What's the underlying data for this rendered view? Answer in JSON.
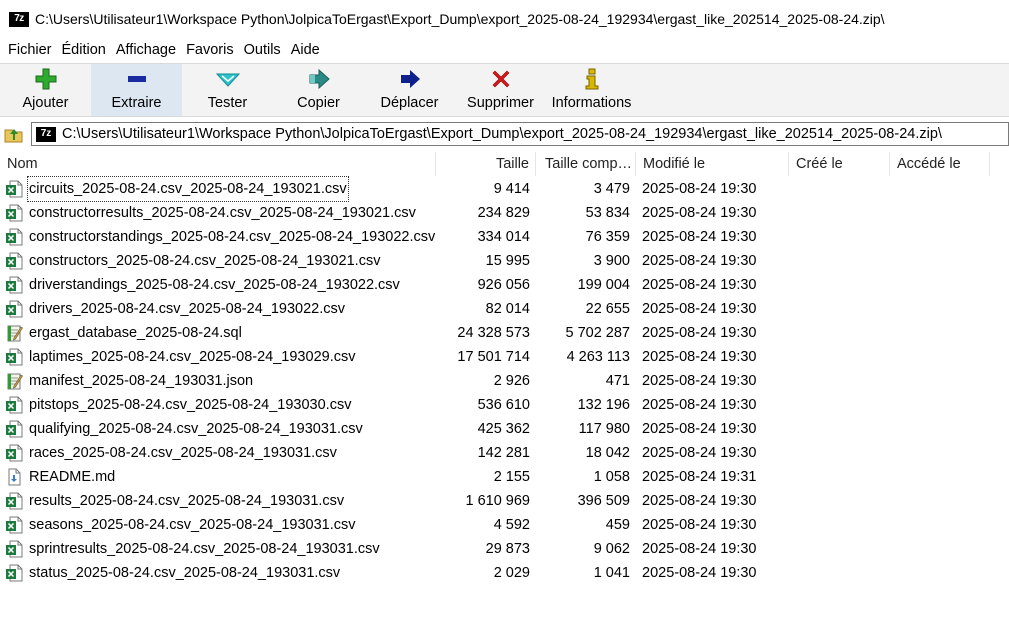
{
  "window": {
    "app_badge": "7z",
    "title": "C:\\Users\\Utilisateur1\\Workspace Python\\JolpicaToErgast\\Export_Dump\\export_2025-08-24_192934\\ergast_like_202514_2025-08-24.zip\\"
  },
  "menu": [
    "Fichier",
    "Édition",
    "Affichage",
    "Favoris",
    "Outils",
    "Aide"
  ],
  "toolbar": [
    {
      "label": "Ajouter",
      "icon": "add-plus-icon",
      "color": "#2eaa2e"
    },
    {
      "label": "Extraire",
      "icon": "extract-minus-icon",
      "color": "#1a2aa0"
    },
    {
      "label": "Tester",
      "icon": "test-check-icon",
      "color": "#29c4cc"
    },
    {
      "label": "Copier",
      "icon": "copy-arrow-icon",
      "color": "#2a8a86"
    },
    {
      "label": "Déplacer",
      "icon": "move-arrow-icon",
      "color": "#10208a"
    },
    {
      "label": "Supprimer",
      "icon": "delete-x-icon",
      "color": "#d81818"
    },
    {
      "label": "Informations",
      "icon": "info-icon",
      "color": "#d8b800"
    }
  ],
  "address": {
    "value": "C:\\Users\\Utilisateur1\\Workspace Python\\JolpicaToErgast\\Export_Dump\\export_2025-08-24_192934\\ergast_like_202514_2025-08-24.zip\\"
  },
  "columns": {
    "name": "Nom",
    "size": "Taille",
    "packed": "Taille comp…",
    "modified": "Modifié le",
    "created": "Créé le",
    "accessed": "Accédé le"
  },
  "files": [
    {
      "name": "circuits_2025-08-24.csv_2025-08-24_193021.csv",
      "size": "9 414",
      "packed": "3 479",
      "modified": "2025-08-24 19:30",
      "type": "csv"
    },
    {
      "name": "constructorresults_2025-08-24.csv_2025-08-24_193021.csv",
      "size": "234 829",
      "packed": "53 834",
      "modified": "2025-08-24 19:30",
      "type": "csv"
    },
    {
      "name": "constructorstandings_2025-08-24.csv_2025-08-24_193022.csv",
      "size": "334 014",
      "packed": "76 359",
      "modified": "2025-08-24 19:30",
      "type": "csv"
    },
    {
      "name": "constructors_2025-08-24.csv_2025-08-24_193021.csv",
      "size": "15 995",
      "packed": "3 900",
      "modified": "2025-08-24 19:30",
      "type": "csv"
    },
    {
      "name": "driverstandings_2025-08-24.csv_2025-08-24_193022.csv",
      "size": "926 056",
      "packed": "199 004",
      "modified": "2025-08-24 19:30",
      "type": "csv"
    },
    {
      "name": "drivers_2025-08-24.csv_2025-08-24_193022.csv",
      "size": "82 014",
      "packed": "22 655",
      "modified": "2025-08-24 19:30",
      "type": "csv"
    },
    {
      "name": "ergast_database_2025-08-24.sql",
      "size": "24 328 573",
      "packed": "5 702 287",
      "modified": "2025-08-24 19:30",
      "type": "sql"
    },
    {
      "name": "laptimes_2025-08-24.csv_2025-08-24_193029.csv",
      "size": "17 501 714",
      "packed": "4 263 113",
      "modified": "2025-08-24 19:30",
      "type": "csv"
    },
    {
      "name": "manifest_2025-08-24_193031.json",
      "size": "2 926",
      "packed": "471",
      "modified": "2025-08-24 19:30",
      "type": "json"
    },
    {
      "name": "pitstops_2025-08-24.csv_2025-08-24_193030.csv",
      "size": "536 610",
      "packed": "132 196",
      "modified": "2025-08-24 19:30",
      "type": "csv"
    },
    {
      "name": "qualifying_2025-08-24.csv_2025-08-24_193031.csv",
      "size": "425 362",
      "packed": "117 980",
      "modified": "2025-08-24 19:30",
      "type": "csv"
    },
    {
      "name": "races_2025-08-24.csv_2025-08-24_193031.csv",
      "size": "142 281",
      "packed": "18 042",
      "modified": "2025-08-24 19:30",
      "type": "csv"
    },
    {
      "name": "README.md",
      "size": "2 155",
      "packed": "1 058",
      "modified": "2025-08-24 19:31",
      "type": "md"
    },
    {
      "name": "results_2025-08-24.csv_2025-08-24_193031.csv",
      "size": "1 610 969",
      "packed": "396 509",
      "modified": "2025-08-24 19:30",
      "type": "csv"
    },
    {
      "name": "seasons_2025-08-24.csv_2025-08-24_193031.csv",
      "size": "4 592",
      "packed": "459",
      "modified": "2025-08-24 19:30",
      "type": "csv"
    },
    {
      "name": "sprintresults_2025-08-24.csv_2025-08-24_193031.csv",
      "size": "29 873",
      "packed": "9 062",
      "modified": "2025-08-24 19:30",
      "type": "csv"
    },
    {
      "name": "status_2025-08-24.csv_2025-08-24_193031.csv",
      "size": "2 029",
      "packed": "1 041",
      "modified": "2025-08-24 19:30",
      "type": "csv"
    }
  ],
  "colors": {
    "toolbar_bg": "#f3f3f3",
    "active_button_bg": "#dde7f2",
    "excel_green": "#1d7a3e"
  }
}
